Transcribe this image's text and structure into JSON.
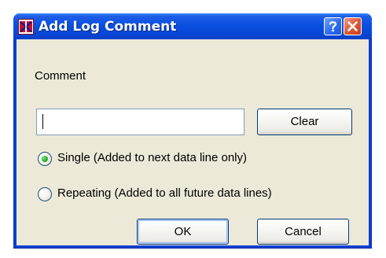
{
  "window": {
    "title": "Add Log Comment",
    "help_label": "?",
    "close_label": "✕"
  },
  "form": {
    "comment_label": "Comment",
    "comment_value": "",
    "clear_label": "Clear",
    "options": [
      {
        "label": "Single (Added to next data line only)",
        "selected": true
      },
      {
        "label": "Repeating (Added to all future data lines)",
        "selected": false
      }
    ],
    "ok_label": "OK",
    "cancel_label": "Cancel"
  },
  "icons": {
    "app": "log-app-icon",
    "help": "help-icon",
    "close": "close-icon"
  },
  "colors": {
    "titlebar": "#0a4fe0",
    "client_background": "#ece9d8",
    "close_button": "#df5a34",
    "radio_selected": "#32b532"
  }
}
